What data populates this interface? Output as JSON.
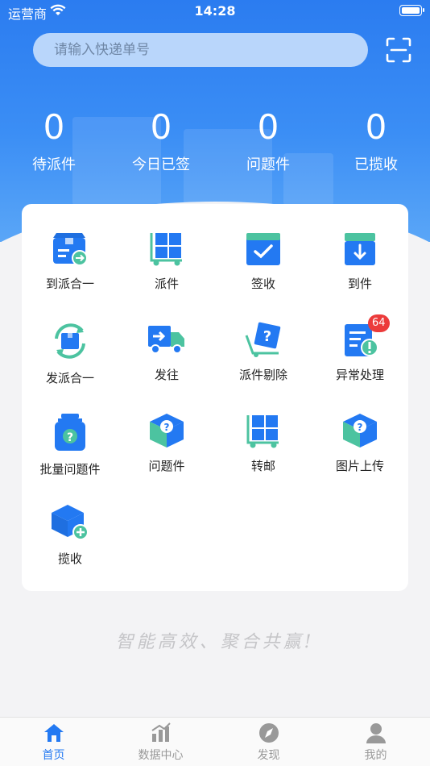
{
  "status_bar": {
    "carrier": "运营商",
    "time": "14:28"
  },
  "search": {
    "placeholder": "请输入快递单号"
  },
  "stats": [
    {
      "value": "0",
      "label": "待派件"
    },
    {
      "value": "0",
      "label": "今日已签"
    },
    {
      "value": "0",
      "label": "问题件"
    },
    {
      "value": "0",
      "label": "已揽收"
    }
  ],
  "menu": [
    {
      "label": "到派合一",
      "icon": "box-arrow-icon"
    },
    {
      "label": "派件",
      "icon": "cart-grid-icon"
    },
    {
      "label": "签收",
      "icon": "check-box-icon"
    },
    {
      "label": "到件",
      "icon": "box-down-arrow-icon"
    },
    {
      "label": "发派合一",
      "icon": "refresh-box-icon"
    },
    {
      "label": "发往",
      "icon": "truck-icon"
    },
    {
      "label": "派件剔除",
      "icon": "cart-question-icon"
    },
    {
      "label": "异常处理",
      "icon": "doc-alert-icon",
      "badge": "64"
    },
    {
      "label": "批量问题件",
      "icon": "jar-question-icon"
    },
    {
      "label": "问题件",
      "icon": "cube-question-icon"
    },
    {
      "label": "转邮",
      "icon": "cart-grid-icon"
    },
    {
      "label": "图片上传",
      "icon": "cube-question-icon"
    },
    {
      "label": "揽收",
      "icon": "cube-plus-icon"
    }
  ],
  "slogan": "智能高效、聚合共赢!",
  "tabbar": [
    {
      "label": "首页",
      "icon": "home-icon",
      "active": true
    },
    {
      "label": "数据中心",
      "icon": "chart-icon",
      "active": false
    },
    {
      "label": "发现",
      "icon": "compass-icon",
      "active": false
    },
    {
      "label": "我的",
      "icon": "user-icon",
      "active": false
    }
  ],
  "colors": {
    "primary": "#2379f2",
    "accent_green": "#4cc3a0",
    "badge": "#ec3b3b"
  }
}
